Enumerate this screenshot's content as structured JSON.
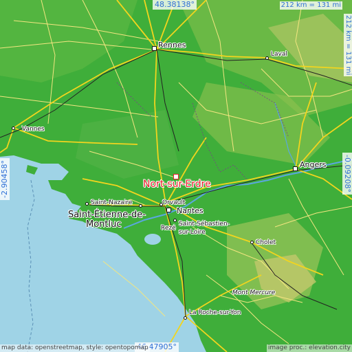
{
  "coords": {
    "top_lat": "48.38138°",
    "bottom_lat": "46.47905°",
    "left_lon": "-2.90458°",
    "right_lon": "-0.09208°"
  },
  "scale": {
    "horizontal": "212 km = 131 mi",
    "vertical": "212 km = 131 mi"
  },
  "target": {
    "name": "Nort-sur-Erdre"
  },
  "places": {
    "rennes": "Rennes",
    "laval": "Laval",
    "vannes": "Vannes",
    "angers": "Angers",
    "saint_nazaire": "Saint-Nazaire",
    "saint_etienne_1": "Saint-Étienne-de-",
    "saint_etienne_2": "Montluc",
    "orvault": "Orvault",
    "nantes": "Nantes",
    "reze": "Rezé",
    "saint_sebastien_1": "Saint-Sébastien-",
    "saint_sebastien_2": "sur-Loire",
    "cholet": "Cholet",
    "mont_mercure": "Mont Mercure",
    "la_roche": "La Roche-sur-Yon"
  },
  "footer": {
    "left": "map data: openstreetmap, style: opentopomap",
    "right": "image proc.: elevation.city"
  },
  "colors": {
    "sea": "#9fd3e6",
    "land": "#3fae3a",
    "target": "#e8202a",
    "coord_text": "#2e6fd6"
  }
}
